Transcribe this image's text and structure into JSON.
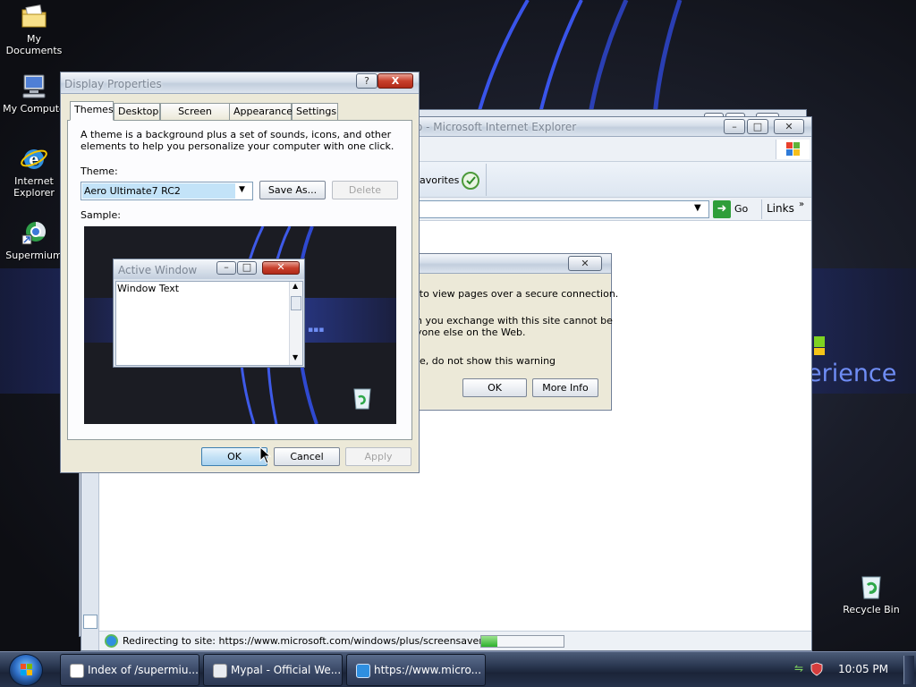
{
  "desktop": {
    "icons": [
      {
        "label": "My Documents"
      },
      {
        "label": "My Compute"
      },
      {
        "label_line1": "Internet",
        "label_line2": "Explorer"
      },
      {
        "label": "Supermium"
      },
      {
        "label": "Recycle Bin"
      }
    ],
    "brand_fragment": "erience"
  },
  "ie_window": {
    "title": "o - Microsoft Internet Explorer",
    "favorites_label": "avorites",
    "go_label": "Go",
    "links_label": "Links",
    "status_text": "Redirecting to site: https://www.microsoft.com/windows/plus/screensavers.asp",
    "progress": 0.2
  },
  "security_dialog": {
    "line1": "t to view pages over a secure connection.",
    "line2": "n you exchange with this site cannot be",
    "line3": "yone else on the Web.",
    "checkbox_label": "e, do not show this warning",
    "ok_label": "OK",
    "more_info_label": "More Info"
  },
  "display_properties": {
    "title": "Display Properties",
    "help_label": "?",
    "close_label": "X",
    "tabs": [
      {
        "label": "Themes"
      },
      {
        "label": "Desktop"
      },
      {
        "label": "Screen Saver"
      },
      {
        "label": "Appearance"
      },
      {
        "label": "Settings"
      }
    ],
    "description": "A theme is a background plus a set of sounds, icons, and other elements to help you personalize your computer with one click.",
    "theme_label": "Theme:",
    "theme_value": "Aero Ultimate7 RC2",
    "save_as_label": "Save As...",
    "delete_label": "Delete",
    "sample_label": "Sample:",
    "sample": {
      "active_window_title": "Active Window",
      "window_text": "Window Text"
    },
    "ok_label": "OK",
    "cancel_label": "Cancel",
    "apply_label": "Apply"
  },
  "taskbar": {
    "tasks": [
      {
        "label": "Index of /supermiu..."
      },
      {
        "label": "Mypal - Official We..."
      },
      {
        "label": "https://www.micro..."
      }
    ],
    "clock": "10:05 PM"
  },
  "colors": {
    "accent_blue": "#3b63ff",
    "title_text": "#7c8694",
    "selection": "#c3e3f8"
  }
}
